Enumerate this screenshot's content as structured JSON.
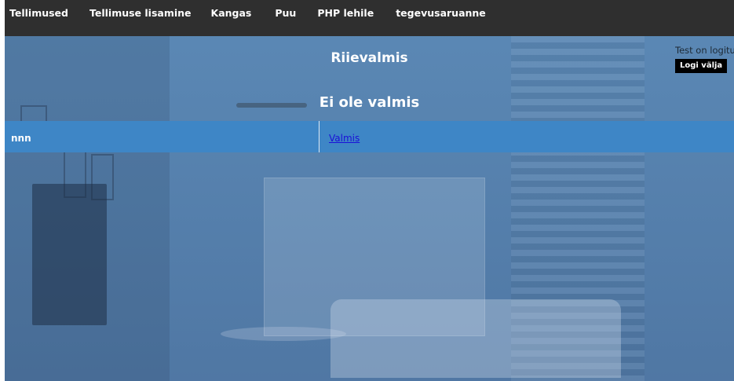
{
  "nav": {
    "items": [
      "Tellimused",
      "Tellimuse lisamine",
      "Kangas",
      "Puu",
      "PHP lehile",
      "tegevusaruanne"
    ]
  },
  "main": {
    "title": "Riievalmis",
    "subtitle": "Ei ole valmis"
  },
  "user": {
    "status_text": "Test on logitud sisse",
    "logout_label": "Logi välja"
  },
  "table": {
    "rows": [
      {
        "name": "nnn",
        "action": "Valmis"
      }
    ]
  },
  "colors": {
    "navbar": "#2f2f2f",
    "row_bg": "#3e86c6",
    "link": "#1a10d8"
  }
}
